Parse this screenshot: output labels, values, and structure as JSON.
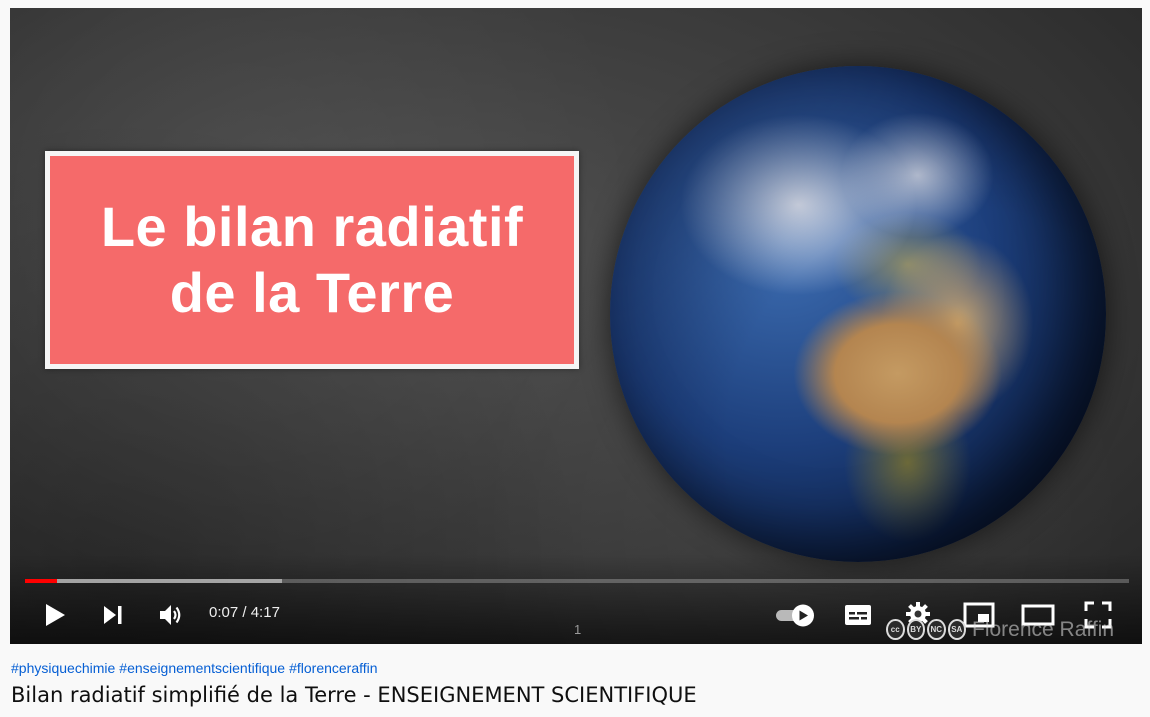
{
  "video": {
    "card_line1": "Le bilan radiatif",
    "card_line2": "de la Terre",
    "watermark": "Florence Raffin",
    "chapter_marker": "1",
    "cc_license": [
      "BY",
      "NC",
      "SA"
    ]
  },
  "player": {
    "current_time": "0:07",
    "time_separator": " / ",
    "duration": "4:17",
    "progress_played_fraction": 0.029,
    "progress_buffered_fraction": 0.233,
    "accent_color": "#ff0000",
    "icons": [
      "play-icon",
      "next-icon",
      "volume-icon",
      "autoplay-toggle-icon",
      "subtitles-icon",
      "settings-icon",
      "miniplayer-icon",
      "theater-mode-icon",
      "fullscreen-icon"
    ]
  },
  "meta": {
    "hashtags": [
      "#physiquechimie",
      "#enseignementscientifique",
      "#florenceraffin"
    ],
    "title": "Bilan radiatif simplifié de la Terre - ENSEIGNEMENT SCIENTIFIQUE"
  }
}
